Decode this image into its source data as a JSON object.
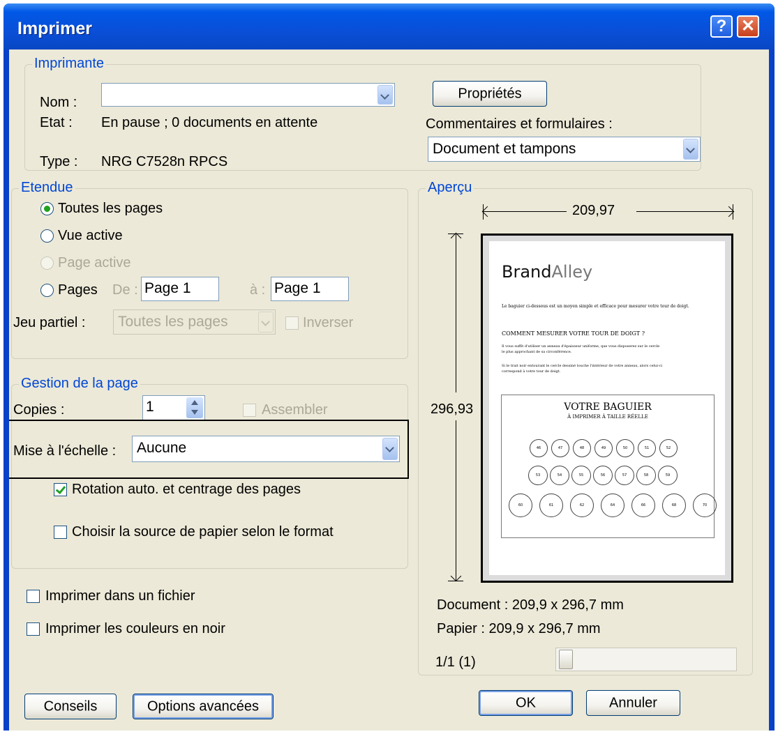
{
  "dialog": {
    "title": "Imprimer",
    "help_glyph": "?",
    "close_glyph": "✕"
  },
  "printer": {
    "legend": "Imprimante",
    "name_label": "Nom :",
    "name_value": "",
    "state_label": "Etat :",
    "state_value": "En pause ; 0 documents en attente",
    "type_label": "Type :",
    "type_value": "NRG C7528n RPCS",
    "properties_button": "Propriétés",
    "comments_label": "Commentaires et formulaires :",
    "comments_value": "Document et tampons"
  },
  "range": {
    "legend": "Etendue",
    "all_pages": "Toutes les pages",
    "active_view": "Vue active",
    "active_page": "Page active",
    "pages": "Pages",
    "from_label": "De :",
    "from_value": "Page 1",
    "to_label": "à :",
    "to_value": "Page 1",
    "subset_label": "Jeu partiel :",
    "subset_value": "Toutes les pages",
    "reverse_label": "Inverser"
  },
  "page_handling": {
    "legend": "Gestion de la page",
    "copies_label": "Copies :",
    "copies_value": "1",
    "collate_label": "Assembler",
    "scaling_label": "Mise à l'échelle :",
    "scaling_value": "Aucune",
    "auto_rotate_label": "Rotation auto. et centrage des pages",
    "paper_source_label": "Choisir la source de papier selon le format"
  },
  "options": {
    "print_to_file": "Imprimer dans un fichier",
    "print_black": "Imprimer les couleurs en noir"
  },
  "preview": {
    "legend": "Aperçu",
    "width_dim": "209,97",
    "height_dim": "296,93",
    "document_size": "Document : 209,9 x 296,7 mm",
    "paper_size": "Papier : 209,9 x 296,7 mm",
    "page_counter": "1/1 (1)",
    "slider_level": 0.0
  },
  "preview_doc": {
    "brand_bold": "Brand",
    "brand_light": "Alley",
    "intro": "Le baguier ci-dessous est un moyen simple et efficace pour mesurer votre tour de doigt.",
    "heading": "COMMENT MESURER VOTRE TOUR DE DOIGT ?",
    "para1_line1": "Il vous suffit d'utiliser un anneau d'épaisseur uniforme, que vous disposerez sur le cercle",
    "para1_line2": "le plus approchant de sa circonférence.",
    "para2_line1": "Si le trait noir entourant le cercle dessiné touche l'intérieur de votre anneau, alors celui-ci",
    "para2_line2": "correspond à votre tour de doigt.",
    "box_title": "VOTRE BAGUIER",
    "box_subtitle": "À IMPRIMER À TAILLE RÉELLE",
    "row1": [
      "46",
      "47",
      "48",
      "49",
      "50",
      "51",
      "52"
    ],
    "row2": [
      "53",
      "54",
      "55",
      "56",
      "57",
      "58",
      "59"
    ],
    "row3": [
      "60",
      "61",
      "62",
      "64",
      "66",
      "68",
      "70"
    ]
  },
  "buttons": {
    "tips": "Conseils",
    "advanced": "Options avancées",
    "ok": "OK",
    "cancel": "Annuler"
  },
  "colors": {
    "title_bar": "#0842c8",
    "dialog_face": "#ece9d8",
    "group_legend": "#0046d5",
    "radio_check_mark": "#21a121"
  }
}
